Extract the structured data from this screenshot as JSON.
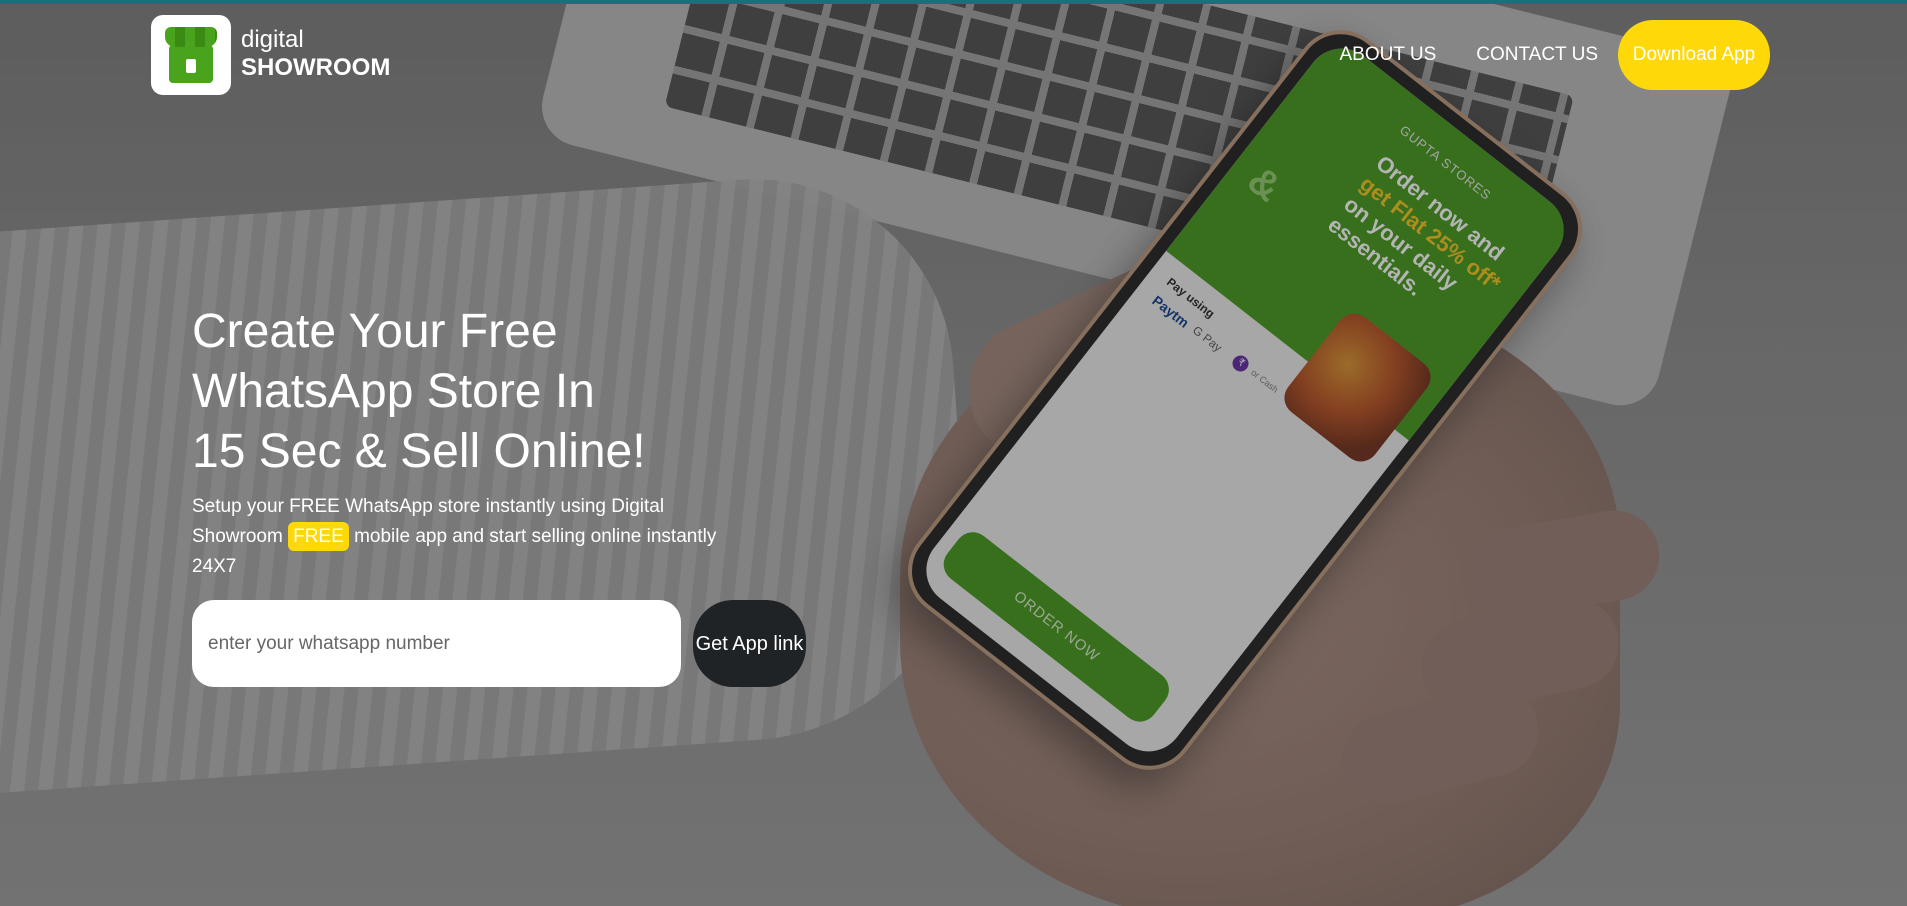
{
  "header": {
    "logo_small": "digital",
    "logo_big": "SHOWROOM",
    "nav": {
      "about": "ABOUT US",
      "contact": "CONTACT US",
      "download": "Download App"
    }
  },
  "hero": {
    "headline_line1": "Create Your Free",
    "headline_line2": "WhatsApp Store In",
    "headline_line3": "15 Sec & Sell Online!",
    "sub_part1": "Setup your FREE WhatsApp store instantly using Digital Showroom",
    "sub_free_tag": "FREE",
    "sub_part2": "mobile app and start selling online instantly 24X7",
    "input_placeholder": "enter your whatsapp number",
    "cta_label": "Get App link"
  },
  "phone_screen": {
    "store_name": "GUPTA STORES",
    "promo_line1": "Order now and",
    "promo_line2": "get Flat 25% off*",
    "promo_line3": "on your daily essentials.",
    "pay_using": "Pay using",
    "paytm": "Paytm",
    "gpay": "G Pay",
    "phonepe": "₹",
    "or_cash": "or Cash",
    "order_button": "ORDER NOW"
  },
  "colors": {
    "accent_yellow": "#ffd80a",
    "brand_green": "#4aa31c",
    "cta_dark": "#202326",
    "top_line": "#17707a"
  }
}
